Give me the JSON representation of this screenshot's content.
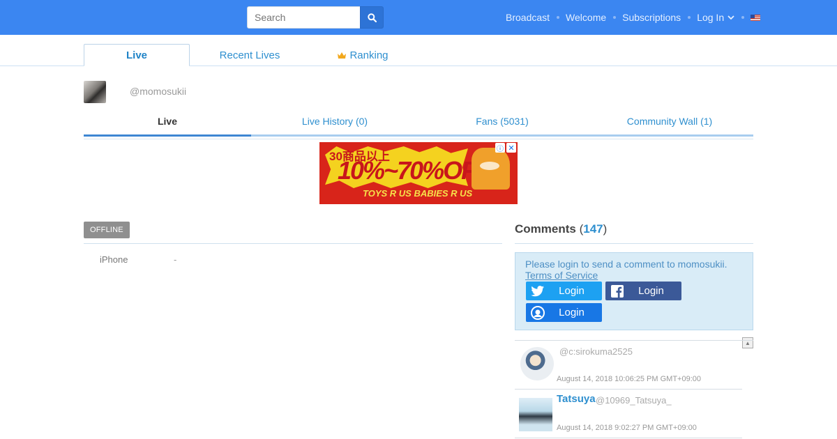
{
  "header": {
    "search_placeholder": "Search",
    "nav": {
      "broadcast": "Broadcast",
      "welcome": "Welcome",
      "subscriptions": "Subscriptions",
      "login": "Log In"
    },
    "language_flag_icon": "us-flag-icon",
    "search_icon": "search-icon"
  },
  "main_tabs": {
    "live": "Live",
    "recent_lives": "Recent Lives",
    "ranking": "Ranking",
    "ranking_icon": "crown-icon"
  },
  "profile": {
    "username": "@momosukii"
  },
  "sub_tabs": {
    "live": "Live",
    "history": "Live History (0)",
    "fans": "Fans (5031)",
    "wall": "Community Wall (1)"
  },
  "ad": {
    "headline_small": "30商品以上",
    "headline_big": "10%~70%OFF",
    "brands": "TOYS R US   BABIES R US",
    "info_icon": "ⓘ",
    "close_icon": "✕"
  },
  "broadcast": {
    "status_badge": "OFFLINE",
    "device_label": "iPhone",
    "device_value": "-"
  },
  "comments": {
    "title": "Comments",
    "count": "147",
    "login_prompt": "Please login to send a comment to momosukii.",
    "terms_link": "Terms of Service",
    "twitter_login": "Login",
    "facebook_login": "Login",
    "other_login": "Login",
    "items": [
      {
        "name": "",
        "handle": "@c:sirokuma2525",
        "time": "August 14, 2018 10:06:25 PM GMT+09:00"
      },
      {
        "name": "Tatsuya",
        "handle": "@10969_Tatsuya_",
        "time": "August 14, 2018 9:02:27 PM GMT+09:00"
      }
    ]
  },
  "colors": {
    "topbar": "#3b86f1",
    "link": "#2e8fcf",
    "badge": "#8f8f8f",
    "twitter": "#1da1f2",
    "facebook": "#3b5998"
  }
}
